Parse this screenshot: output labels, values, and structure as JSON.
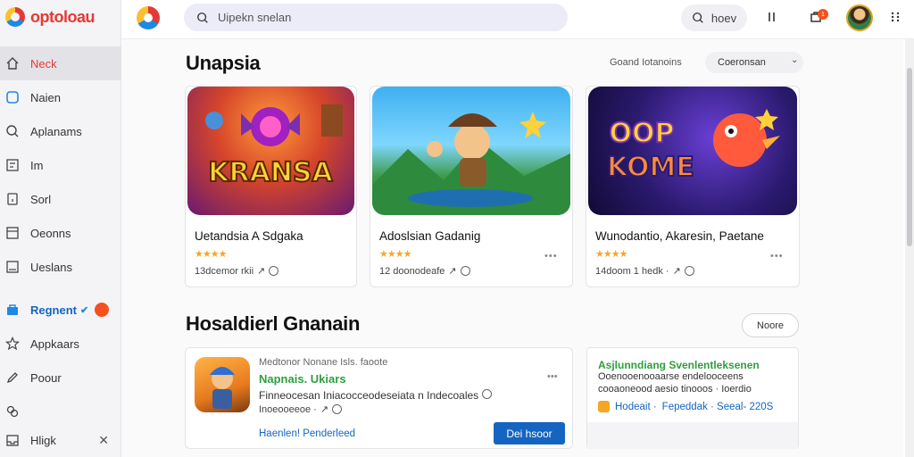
{
  "brand": {
    "name": "optoloau"
  },
  "search": {
    "placeholder": "Uipekn snelan"
  },
  "topbar": {
    "search_button": "hoev",
    "notification_count": "1",
    "icon_names": [
      "search-icon",
      "library-icon",
      "bell-icon",
      "more-vertical-icon"
    ]
  },
  "sidebar": {
    "items": [
      {
        "label": "Neck",
        "icon": "home-icon"
      },
      {
        "label": "Naien",
        "icon": "tablet-icon"
      },
      {
        "label": "Aplanams",
        "icon": "search-icon"
      },
      {
        "label": "Im",
        "icon": "grid-icon"
      },
      {
        "label": "Sorl",
        "icon": "box-icon"
      },
      {
        "label": "Oeonns",
        "icon": "square-icon"
      },
      {
        "label": "Ueslans",
        "icon": "window-icon"
      },
      {
        "label": "Regnent",
        "icon": "bag-icon"
      },
      {
        "label": "Appkaars",
        "icon": "star-icon"
      },
      {
        "label": "Poour",
        "icon": "edit-icon"
      },
      {
        "label": "",
        "icon": "link-icon"
      }
    ],
    "bottom": {
      "label": "Hligk",
      "icon": "inbox-icon"
    }
  },
  "section1": {
    "title": "Unapsia",
    "filter_label": "Goand Iotanoins",
    "sort_value": "Coeronsan",
    "apps": [
      {
        "name": "Uetandsia A Sdgaka",
        "stars": "★★★★",
        "meta": "13dcemor rkii",
        "art_text": "KRANSA"
      },
      {
        "name": "Adoslsian Gadanig",
        "stars": "★★★★",
        "meta": "12 doonodeafe",
        "art_text": ""
      },
      {
        "name": "Wunodantio, Akaresin, Paetane",
        "stars": "★★★★",
        "meta": "14doom 1 hedk ·",
        "art_text": "OOP KOME"
      }
    ]
  },
  "section2": {
    "title": "Hosaldierl Gnanain",
    "more_button": "Noore",
    "featured": {
      "subtitle": "Medtonor Nonane Isls. faoote",
      "name": "Napnais. Ukiars",
      "desc1": "Finneocesan Iniacocceodeseiata n Indecoales",
      "desc2": "Inoeooeeoe ·",
      "link": "Haenlen! Penderleed",
      "button": "Dei hsoor"
    },
    "promo": {
      "title": "Asjlunndiang Svenlentleksenen",
      "line2": "Ooenooenooaarse endelooceens",
      "line3": "cooaoneood aesio tinooos · Ioerdio",
      "badge_left": "Hodeait ·",
      "badge_right": "Fepeddak · Seeal- 220S"
    }
  },
  "colors": {
    "accent": "#e53935",
    "primary": "#1565c0",
    "green": "#2e9e3e",
    "star": "#f5a623"
  }
}
